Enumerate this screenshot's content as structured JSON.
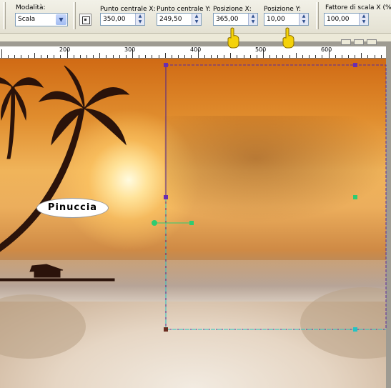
{
  "toolbar": {
    "mode_label": "Modalità:",
    "mode_value": "Scala",
    "center_x_label": "Punto centrale X:",
    "center_x_value": "350,00",
    "center_y_label": "Punto centrale Y:",
    "center_y_value": "249,50",
    "pos_x_label": "Posizione X:",
    "pos_x_value": "365,00",
    "pos_y_label": "Posizione Y:",
    "pos_y_value": "10,00",
    "scale_x_label": "Fattore di scala X (%):",
    "scale_x_value": "100,00"
  },
  "ruler": {
    "numbers": [
      "200",
      "300",
      "400",
      "500",
      "600"
    ]
  },
  "watermark": "Pinuccia",
  "colors": {
    "selection": "#5a2da0",
    "handle_green": "#2ecc71",
    "handle_cyan": "#23c3c3",
    "pointer_hand": "#f4d20a"
  },
  "icons": [
    "pick-tool-icon",
    "pointing-hand-icon"
  ]
}
